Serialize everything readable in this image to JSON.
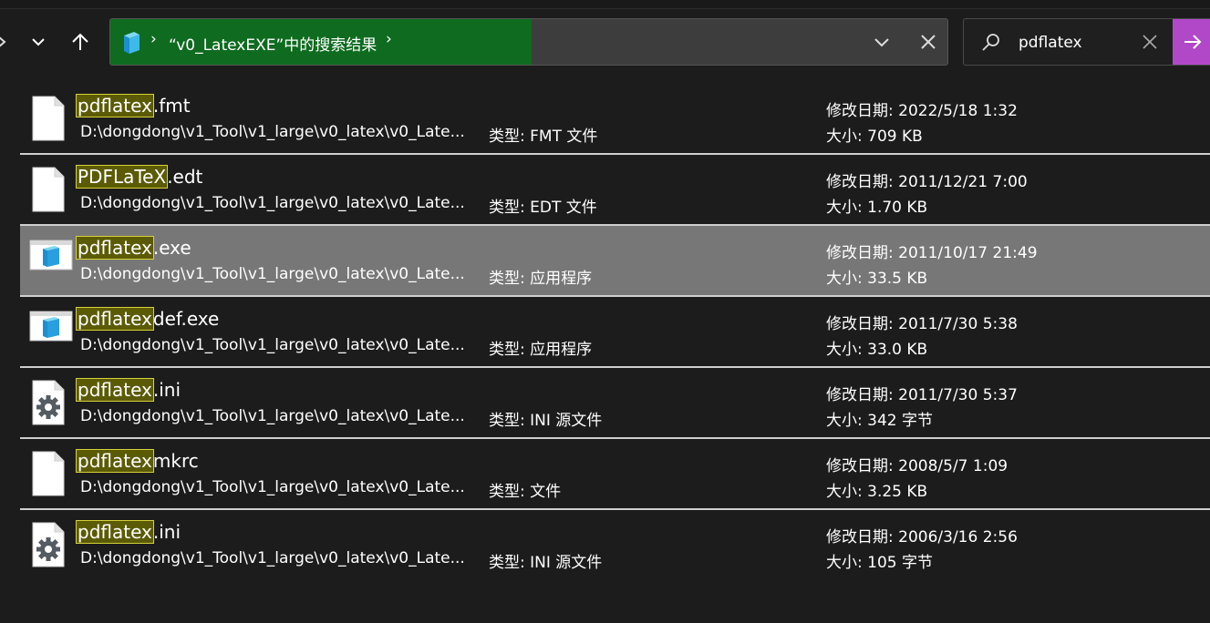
{
  "nav": {
    "forward_icon": "chevron-right-icon",
    "recent_icon": "chevron-down-icon",
    "up_icon": "arrow-up-icon"
  },
  "address": {
    "text": "“v0_LatexEXE”中的搜索结果",
    "separator": "›",
    "folder_icon": "search-folder-icon",
    "progress_color": "#0e6b1f"
  },
  "search": {
    "value": "pdflatex",
    "go_color": "#b148c8"
  },
  "labels": {
    "date_prefix": "修改日期: ",
    "size_prefix": "大小: ",
    "type_prefix": "类型: "
  },
  "results": [
    {
      "name_hl": "pdflatex",
      "name_rest": ".fmt",
      "path": "D:\\dongdong\\v1_Tool\\v1_large\\v0_latex\\v0_Late...",
      "type": "FMT 文件",
      "date": "2022/5/18 1:32",
      "size": "709 KB",
      "icon": "file-icon",
      "selected": false
    },
    {
      "name_hl": "PDFLaTeX",
      "name_rest": ".edt",
      "path": "D:\\dongdong\\v1_Tool\\v1_large\\v0_latex\\v0_Late...",
      "type": "EDT 文件",
      "date": "2011/12/21 7:00",
      "size": "1.70 KB",
      "icon": "file-icon",
      "selected": false
    },
    {
      "name_hl": "pdflatex",
      "name_rest": ".exe",
      "path": "D:\\dongdong\\v1_Tool\\v1_large\\v0_latex\\v0_Late...",
      "type": "应用程序",
      "date": "2011/10/17 21:49",
      "size": "33.5 KB",
      "icon": "app-window-icon",
      "selected": true
    },
    {
      "name_hl": "pdflatex",
      "name_rest": "def.exe",
      "path": "D:\\dongdong\\v1_Tool\\v1_large\\v0_latex\\v0_Late...",
      "type": "应用程序",
      "date": "2011/7/30 5:38",
      "size": "33.0 KB",
      "icon": "app-window-icon",
      "selected": false
    },
    {
      "name_hl": "pdflatex",
      "name_rest": ".ini",
      "path": "D:\\dongdong\\v1_Tool\\v1_large\\v0_latex\\v0_Late...",
      "type": "INI 源文件",
      "date": "2011/7/30 5:37",
      "size": "342 字节",
      "icon": "settings-file-icon",
      "selected": false
    },
    {
      "name_hl": "pdflatex",
      "name_rest": "mkrc",
      "path": "D:\\dongdong\\v1_Tool\\v1_large\\v0_latex\\v0_Late...",
      "type": "文件",
      "date": "2008/5/7 1:09",
      "size": "3.25 KB",
      "icon": "file-icon",
      "selected": false
    },
    {
      "name_hl": "pdflatex",
      "name_rest": ".ini",
      "path": "D:\\dongdong\\v1_Tool\\v1_large\\v0_latex\\v0_Late...",
      "type": "INI 源文件",
      "date": "2006/3/16 2:56",
      "size": "105 字节",
      "icon": "settings-file-icon",
      "selected": false
    }
  ],
  "colors": {
    "background": "#1c1c1c",
    "selected_row": "#777777",
    "highlight_bg": "#5b5b06",
    "highlight_border": "#d6d13a"
  }
}
